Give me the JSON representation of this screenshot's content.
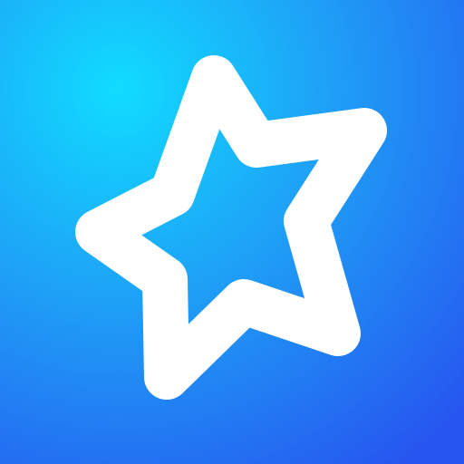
{
  "app_icon": {
    "icon": "star-outline-icon",
    "colors": {
      "gradient_start": "#10dcff",
      "gradient_mid": "#1ea0f6",
      "gradient_end": "#2655ef",
      "star_stroke": "#ffffff"
    }
  }
}
